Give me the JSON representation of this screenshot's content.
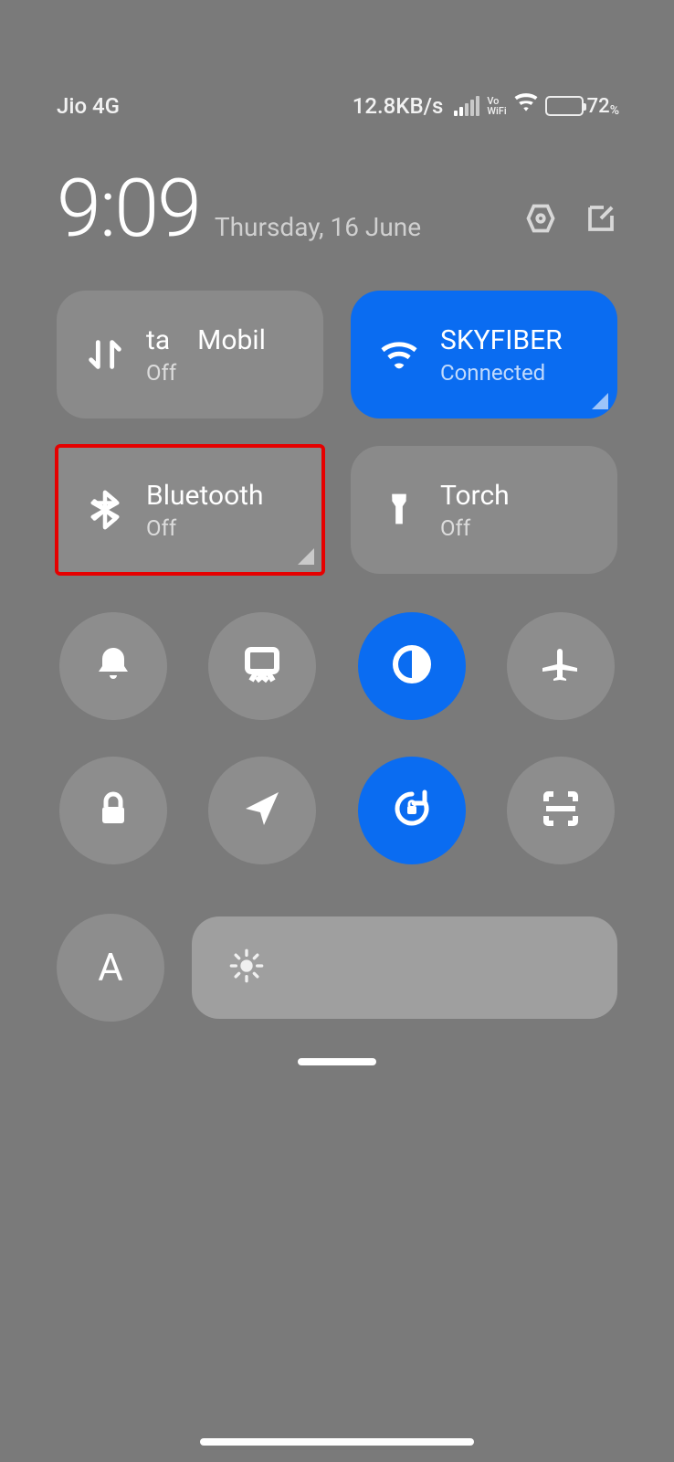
{
  "status": {
    "carrier": "Jio 4G",
    "speed": "12.8KB/s",
    "vowifi_top": "Vo",
    "vowifi_bottom": "WiFi",
    "battery_pct": "72",
    "battery_pct_suffix": "%"
  },
  "header": {
    "time": "9:09",
    "date": "Thursday, 16 June"
  },
  "tiles": {
    "mobile_data": {
      "label_part1": "ta",
      "label_part2": "Mobil",
      "status": "Off"
    },
    "wifi": {
      "title": "SKYFIBER",
      "status": "Connected"
    },
    "bluetooth": {
      "title": "Bluetooth",
      "status": "Off"
    },
    "torch": {
      "title": "Torch",
      "status": "Off"
    }
  },
  "round_icons": {
    "sound": "bell-icon",
    "screenshot": "scissors-icon",
    "dark_mode": "contrast-icon",
    "airplane": "airplane-icon",
    "lock": "lock-icon",
    "location": "navigation-icon",
    "rotation_lock": "rotation-lock-icon",
    "scanner": "scan-icon"
  },
  "brightness": {
    "auto_label": "A"
  }
}
